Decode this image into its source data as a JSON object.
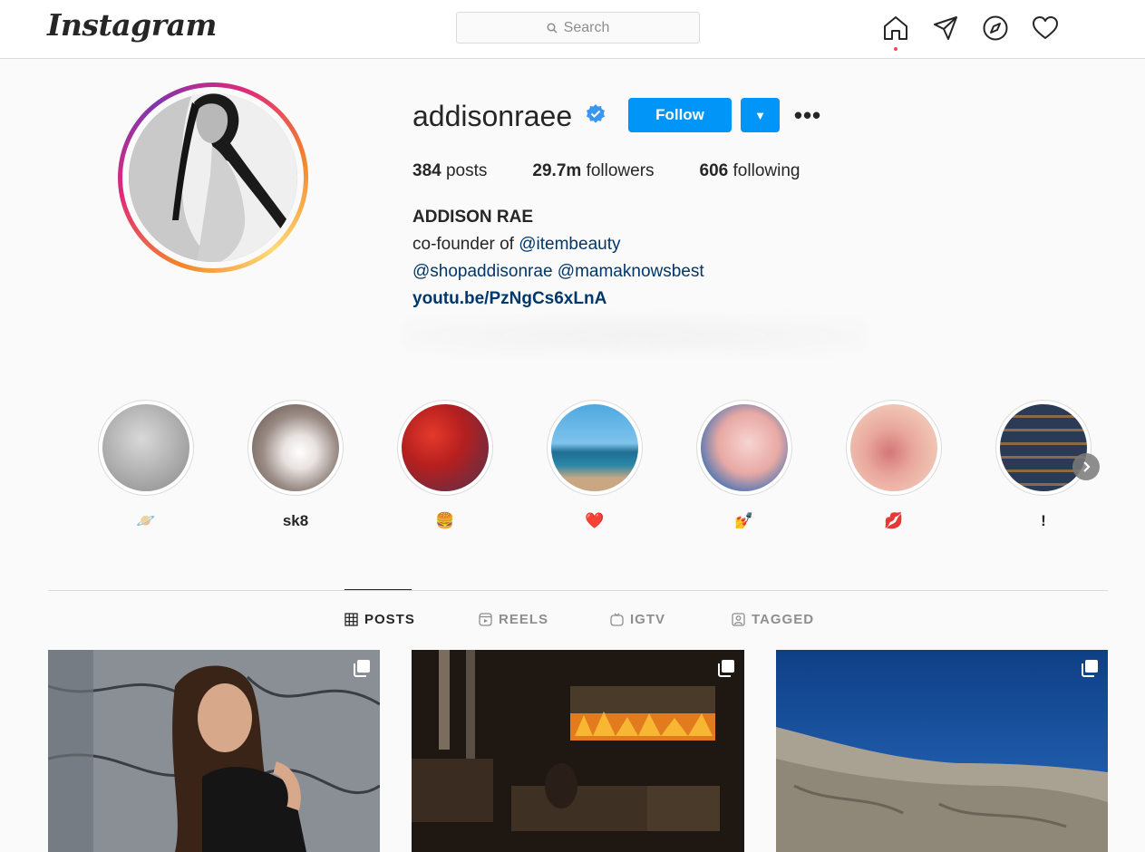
{
  "nav": {
    "logo": "Instagram",
    "search_placeholder": "Search",
    "icons": [
      "home-icon",
      "direct-icon",
      "explore-icon",
      "activity-icon"
    ]
  },
  "profile": {
    "username": "addisonraee",
    "verified": true,
    "follow_label": "Follow",
    "stats": {
      "posts_value": "384",
      "posts_label": "posts",
      "followers_value": "29.7m",
      "followers_label": "followers",
      "following_value": "606",
      "following_label": "following"
    },
    "full_name": "ADDISON RAE",
    "bio": {
      "line1_prefix": "co-founder of ",
      "line1_mention": "@itembeauty",
      "line2_mention1": "@shopaddisonrae",
      "line2_mention2": "@mamaknowsbest"
    },
    "link": "youtu.be/PzNgCs6xLnA"
  },
  "highlights": [
    {
      "label": "🪐",
      "image": "moon"
    },
    {
      "label": "sk8",
      "image": "person-white"
    },
    {
      "label": "🍔",
      "image": "cherries"
    },
    {
      "label": "❤️",
      "image": "beach"
    },
    {
      "label": "💅",
      "image": "nails"
    },
    {
      "label": "💋",
      "image": "lips"
    },
    {
      "label": "!",
      "image": "shelves"
    }
  ],
  "tabs": [
    {
      "label": "POSTS",
      "icon": "grid-icon",
      "active": true
    },
    {
      "label": "REELS",
      "icon": "reels-icon",
      "active": false
    },
    {
      "label": "IGTV",
      "icon": "igtv-icon",
      "active": false
    },
    {
      "label": "TAGGED",
      "icon": "tagged-icon",
      "active": false
    }
  ],
  "posts": [
    {
      "image": "marble-portrait",
      "multi": true
    },
    {
      "image": "dark-room-fireplace",
      "multi": true
    },
    {
      "image": "rock-blue-sky",
      "multi": true
    }
  ],
  "colors": {
    "accent": "#0095f6",
    "link": "#00376b",
    "border": "#dbdbdb",
    "background": "#fafafa"
  }
}
